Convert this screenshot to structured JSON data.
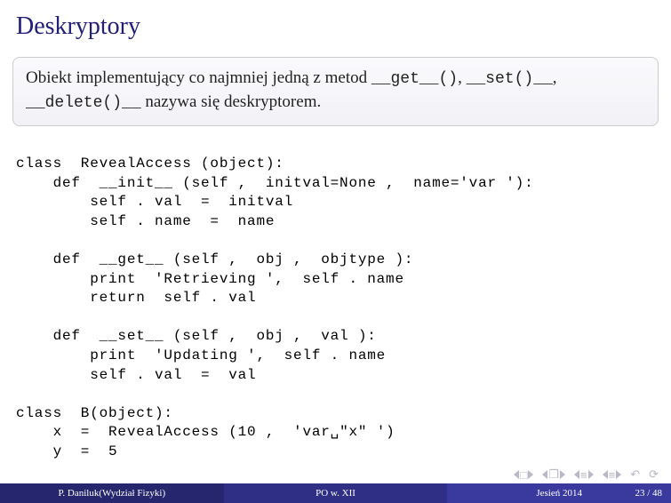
{
  "title": "Deskryptory",
  "block": {
    "line1_pre": "Obiekt implementujący co najmniej jedną z metod ",
    "m1": "__get__()",
    "sep1": ", ",
    "m2": "__set()__",
    "sep2": ",",
    "line2_m3": "__delete()__",
    "line2_rest": " nazywa się deskryptorem."
  },
  "code": {
    "l1": "class  RevealAccess (object):",
    "l2": "    def  __init__ (self ,  initval=None ,  name='var '):",
    "l3": "        self . val  =  initval",
    "l4": "        self . name  =  name",
    "l5": "",
    "l6": "    def  __get__ (self ,  obj ,  objtype ):",
    "l7": "        print  'Retrieving ',  self . name",
    "l8": "        return  self . val",
    "l9": "",
    "l10": "    def  __set__ (self ,  obj ,  val ):",
    "l11": "        print  'Updating ',  self . name",
    "l12": "        self . val  =  val",
    "l13": "",
    "l14": "class  B(object):",
    "l15": "    x  =  RevealAccess (10 ,  'var␣\"x\" ')",
    "l16": "    y  =  5"
  },
  "footer": {
    "left": "P. Daniluk(Wydział Fizyki)",
    "mid": "PO w. XII",
    "right_term": "Jesień 2014",
    "pages": "23 / 48"
  }
}
